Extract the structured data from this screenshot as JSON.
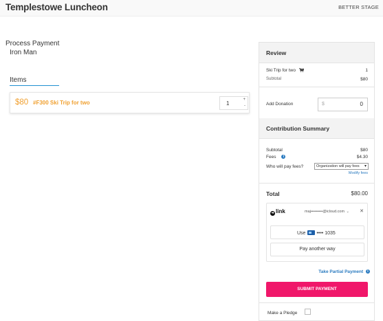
{
  "header": {
    "title": "Templestowe Luncheon",
    "brand": "BETTER STAGE"
  },
  "main": {
    "process_title": "Process Payment",
    "customer_name": "Iron Man",
    "items_heading": "Items",
    "item": {
      "price": "$80",
      "name": "#F300 Ski Trip for two",
      "quantity": "1",
      "qty_up": "+",
      "qty_down": "-"
    }
  },
  "review": {
    "heading": "Review",
    "item_name": "Ski Trip for two",
    "item_icon": "cart-icon",
    "item_qty": "1",
    "subtotal_label": "Subtotal",
    "subtotal_value": "$80",
    "donation_label": "Add Donation",
    "donation_currency": "$",
    "donation_value": "0"
  },
  "contribution": {
    "heading": "Contribution Summary",
    "subtotal_label": "Subtotal",
    "subtotal_value": "$80",
    "fees_label": "Fees",
    "fees_value": "$4.30",
    "payer_label": "Who will pay fees?",
    "payer_selected": "Organization will pay fees",
    "modify_fees": "Modify fees"
  },
  "payment": {
    "total_label": "Total",
    "total_value": "$80.00",
    "link_brand": "link",
    "link_email": "maj•••••••••@icloud.com",
    "use_label": "Use",
    "card_digits": "•••• 1035",
    "pay_another": "Pay another way",
    "partial_payment": "Take Partial Payment",
    "submit": "SUBMIT PAYMENT",
    "pledge_label": "Make a Pledge"
  },
  "colors": {
    "accent": "#f0176a",
    "item_orange": "#f0a030",
    "link_blue": "#2b7bc0",
    "tab_underline": "#1f8fd1"
  }
}
